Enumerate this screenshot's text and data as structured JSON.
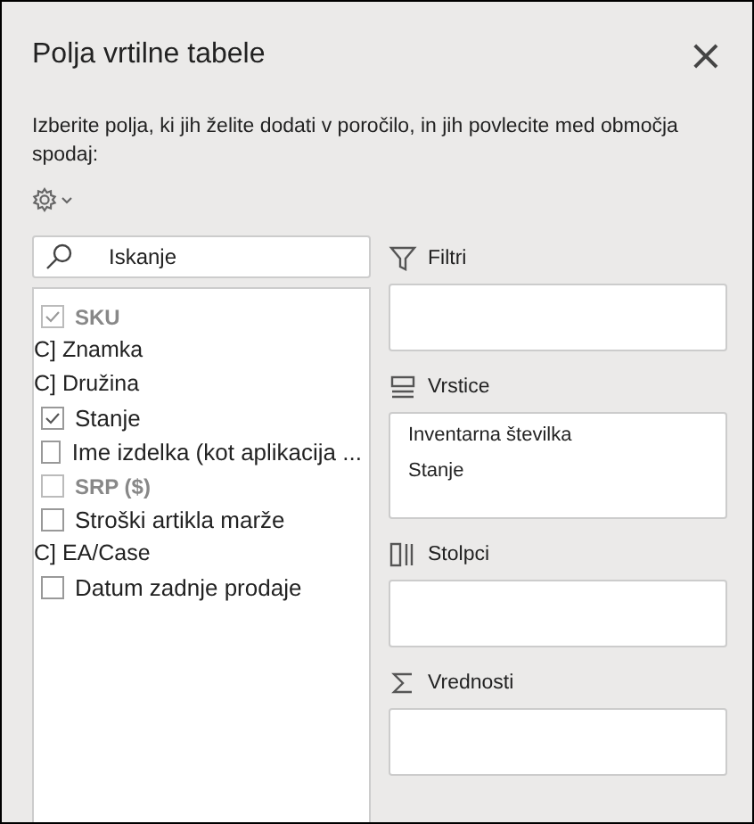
{
  "panel": {
    "title": "Polja vrtilne tabele",
    "close": "×",
    "instructions": "Izberite polja, ki jih želite dodati v poročilo, in jih povlecite med območja spodaj:"
  },
  "search": {
    "placeholder": "Iskanje"
  },
  "fields": [
    {
      "kind": "checkbox",
      "label": "SKU",
      "checked": true,
      "disabled": true
    },
    {
      "kind": "plain",
      "label": "C] Znamka"
    },
    {
      "kind": "plain",
      "label": "C] Družina"
    },
    {
      "kind": "checkbox",
      "label": "Stanje",
      "checked": true,
      "disabled": false
    },
    {
      "kind": "checkbox",
      "label": "Ime izdelka (kot aplikacija ...",
      "checked": false,
      "disabled": false
    },
    {
      "kind": "checkbox",
      "label": "SRP ($)",
      "checked": false,
      "disabled": true
    },
    {
      "kind": "checkbox",
      "label": "Stroški artikla marže",
      "checked": false,
      "disabled": false
    },
    {
      "kind": "plain",
      "label": "C] EA/Case"
    },
    {
      "kind": "checkbox",
      "label": "Datum zadnje prodaje",
      "checked": false,
      "disabled": false
    }
  ],
  "areas": [
    {
      "kind": "filter",
      "label": "Filtri"
    },
    {
      "kind": "rows",
      "label": "Vrstice",
      "items": [
        "Inventarna številka",
        "Stanje"
      ]
    },
    {
      "kind": "columns",
      "label": "Stolpci"
    },
    {
      "kind": "values",
      "label": "Vrednosti"
    }
  ]
}
